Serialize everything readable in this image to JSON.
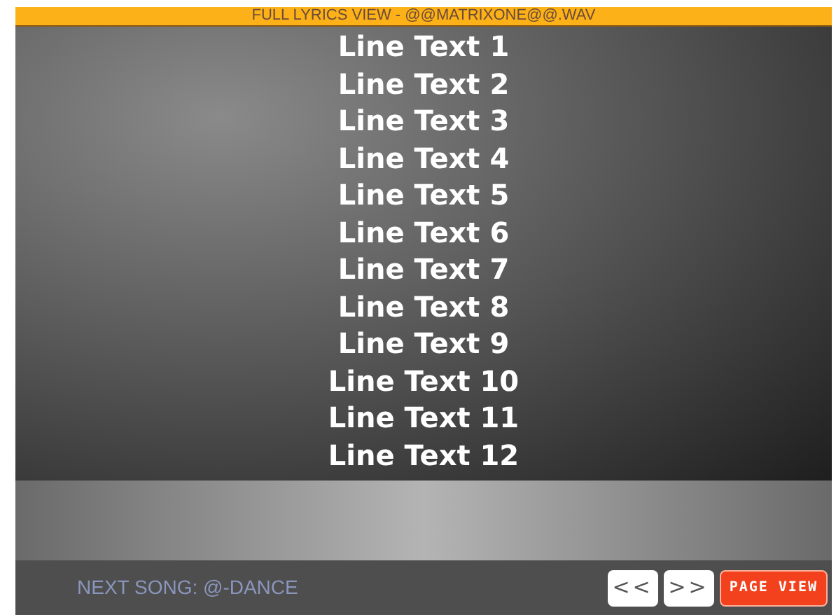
{
  "title": "FULL LYRICS VIEW - @@MATRIXONE@@.WAV",
  "lyrics": [
    "Line Text 1",
    "Line Text 2",
    "Line Text 3",
    "Line Text 4",
    "Line Text 5",
    "Line Text 6",
    "Line Text 7",
    "Line Text 8",
    "Line Text 9",
    "Line Text 10",
    "Line Text 11",
    "Line Text 12"
  ],
  "next_song": "NEXT SONG: @-DANCE",
  "buttons": [
    {
      "kind": "nav",
      "label": "<<"
    },
    {
      "kind": "nav",
      "label": ">>"
    },
    {
      "kind": "primary",
      "label": "PAGE VIEW"
    }
  ]
}
